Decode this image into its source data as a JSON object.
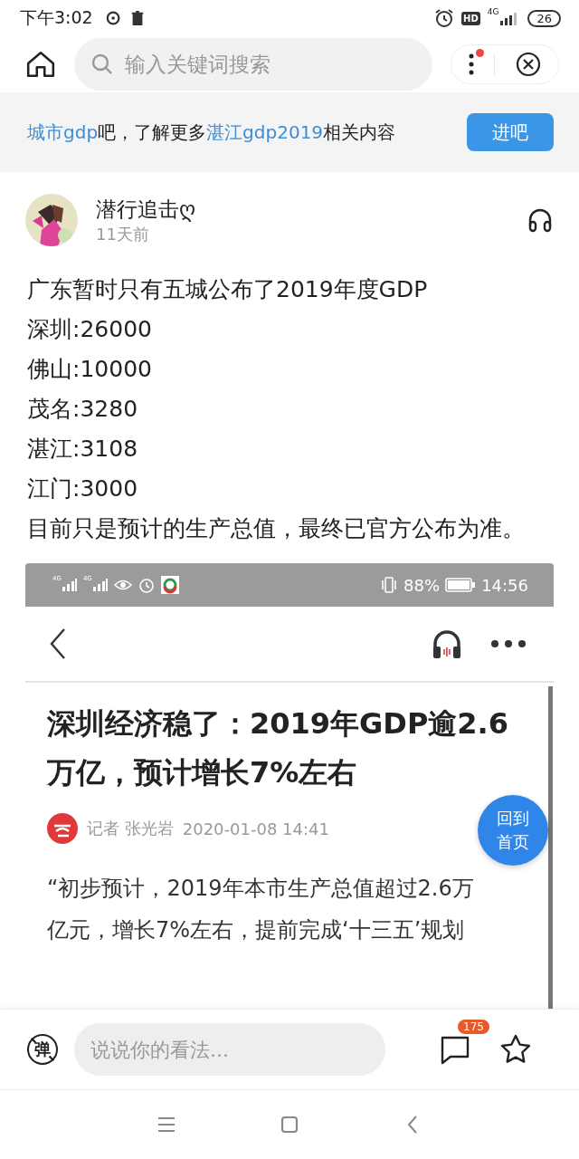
{
  "status_bar": {
    "time": "下午3:02",
    "hd": "HD",
    "network": "4G",
    "battery": "26"
  },
  "browser": {
    "search": {
      "placeholder": "输入关键词搜索"
    },
    "menu_notification": true
  },
  "banner": {
    "segments": [
      {
        "text": "城市gdp",
        "highlight": true
      },
      {
        "text": "吧，了解更多",
        "highlight": false
      },
      {
        "text": "湛江gdp2019",
        "highlight": true
      },
      {
        "text": "相关内容",
        "highlight": false
      }
    ],
    "button": "进吧"
  },
  "post": {
    "author": "潜行追击ღ",
    "time": "11天前",
    "lines": [
      "广东暂时只有五城公布了2019年度GDP",
      "深圳:26000",
      "佛山:10000",
      "茂名:3280",
      "湛江:3108",
      "江门:3000",
      "目前只是预计的生产总值，最终已官方公布为准。"
    ]
  },
  "embedded": {
    "status": {
      "network": [
        "4G",
        "4G"
      ],
      "battery": "88%",
      "time": "14:56"
    },
    "title": "深圳经济稳了：2019年GDP逾2.6万亿，预计增长7%左右",
    "reporter": "记者 张光岩",
    "date": "2020-01-08 14:41",
    "paragraph": [
      "“初步预计，2019年本市生产总值超过2.6万",
      "亿元，增长7%左右，提前完成‘十三五’规划"
    ],
    "back_to_top": "回到首页"
  },
  "comment_bar": {
    "danmaku": "弹",
    "placeholder": "说说你的看法...",
    "comment_count": "175"
  }
}
